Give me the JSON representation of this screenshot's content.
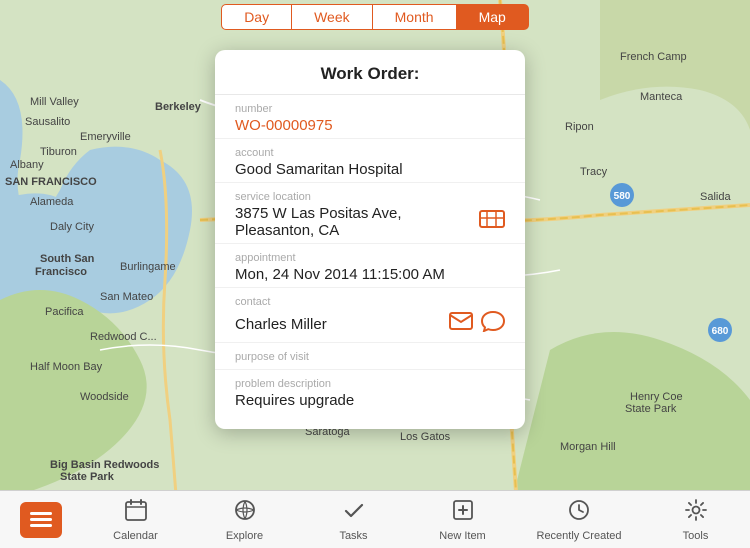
{
  "topNav": {
    "tabs": [
      {
        "label": "Day",
        "active": false
      },
      {
        "label": "Week",
        "active": false
      },
      {
        "label": "Month",
        "active": false
      },
      {
        "label": "Map",
        "active": true
      }
    ]
  },
  "workOrder": {
    "title": "Work Order:",
    "fields": {
      "number_label": "number",
      "number_value": "WO-00000975",
      "account_label": "account",
      "account_value": "Good Samaritan Hospital",
      "service_location_label": "service location",
      "service_location_value": "3875 W Las Positas Ave, Pleasanton, CA",
      "appointment_label": "appointment",
      "appointment_value": "Mon, 24 Nov 2014 11:15:00 AM",
      "contact_label": "contact",
      "contact_value": "Charles Miller",
      "purpose_label": "purpose of visit",
      "purpose_value": "",
      "problem_label": "problem description",
      "problem_value": "Requires upgrade"
    }
  },
  "bottomNav": {
    "items": [
      {
        "label": "Calendar",
        "icon": "calendar"
      },
      {
        "label": "Explore",
        "icon": "globe"
      },
      {
        "label": "Tasks",
        "icon": "check"
      },
      {
        "label": "New Item",
        "icon": "plus-box"
      },
      {
        "label": "Recently Created",
        "icon": "clock"
      },
      {
        "label": "Tools",
        "icon": "gear"
      }
    ]
  },
  "colors": {
    "accent": "#e05a20",
    "white": "#ffffff"
  }
}
